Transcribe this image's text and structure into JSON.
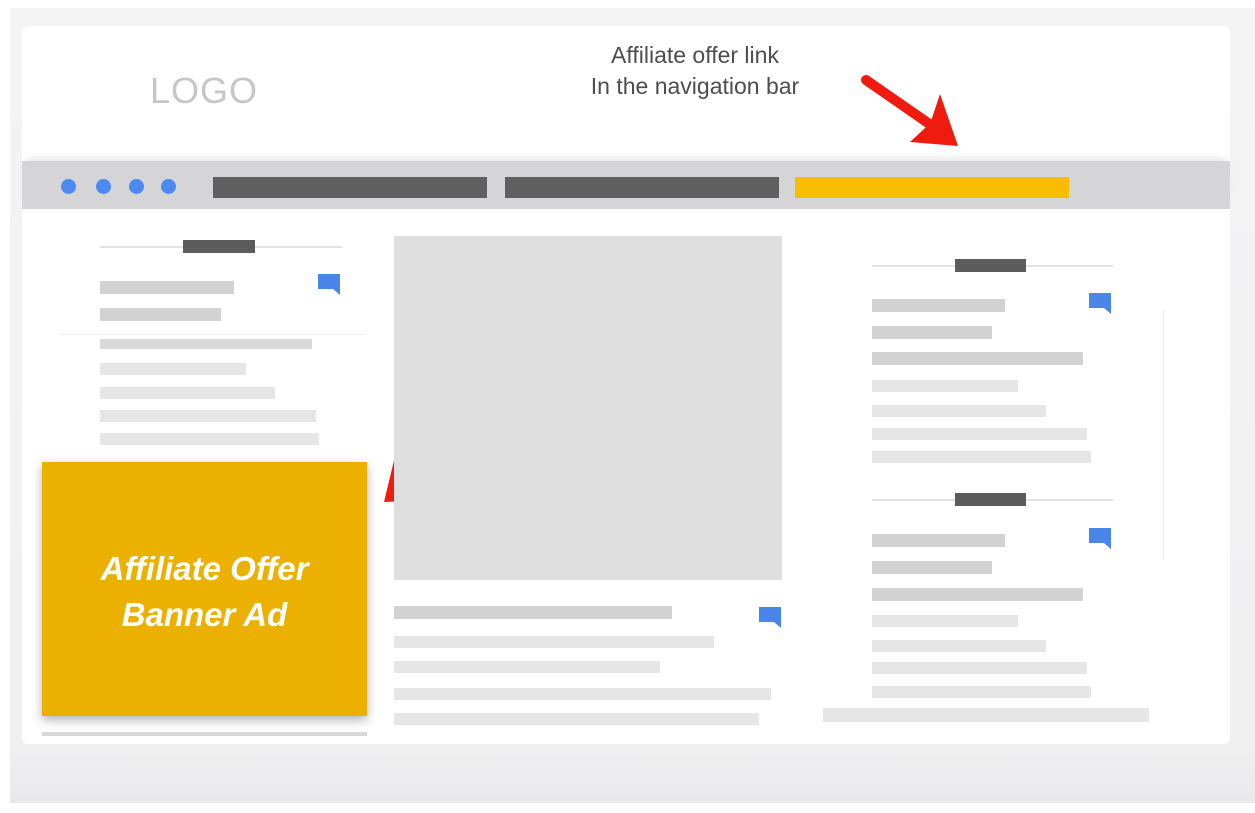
{
  "header": {
    "logo_text": "LOGO",
    "nav_annotation": {
      "line1": "Affiliate offer link",
      "line2": "In the navigation bar"
    }
  },
  "navbar": {
    "dots": 4,
    "links": [
      {
        "name": "nav-link-1",
        "color": "#5f5f5f"
      },
      {
        "name": "nav-link-2",
        "color": "#5f5f5f"
      },
      {
        "name": "affiliate-offer-link",
        "color": "#f8bc00"
      }
    ]
  },
  "banner": {
    "line1": "Affiliate Offer",
    "line2": "Banner Ad",
    "color": "#ecb000"
  },
  "icons": {
    "comment": "comment-icon",
    "arrow": "red-arrow-icon"
  },
  "colors": {
    "dot_blue": "#4c8af1",
    "arrow_red": "#f01b0f",
    "comment_blue": "#4a86e8"
  }
}
